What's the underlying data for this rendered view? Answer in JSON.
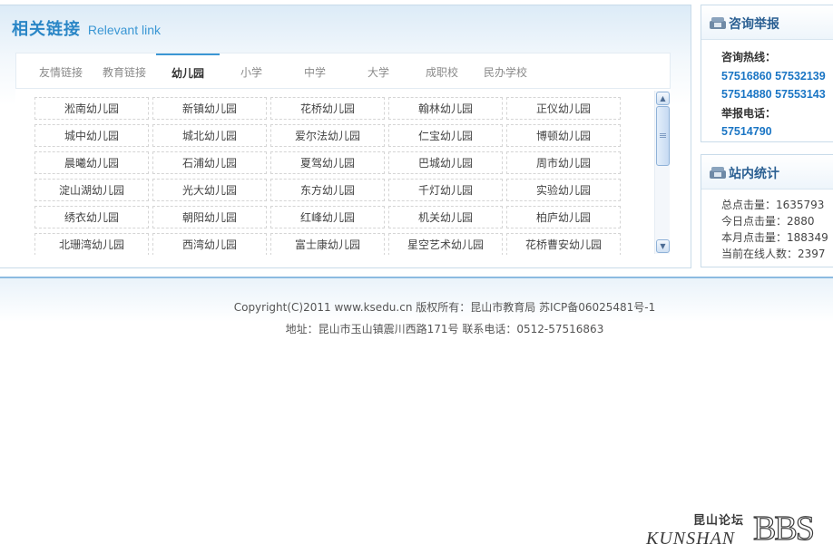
{
  "links_panel": {
    "title_zh": "相关链接",
    "title_en": "Relevant link",
    "tabs": [
      "友情链接",
      "教育链接",
      "幼儿园",
      "小学",
      "中学",
      "大学",
      "成职校",
      "民办学校"
    ],
    "active_tab": "幼儿园",
    "kindergartens": [
      [
        "淞南幼儿园",
        "新镇幼儿园",
        "花桥幼儿园",
        "翰林幼儿园",
        "正仪幼儿园"
      ],
      [
        "城中幼儿园",
        "城北幼儿园",
        "爱尔法幼儿园",
        "仁宝幼儿园",
        "博顿幼儿园"
      ],
      [
        "晨曦幼儿园",
        "石浦幼儿园",
        "夏驾幼儿园",
        "巴城幼儿园",
        "周市幼儿园"
      ],
      [
        "淀山湖幼儿园",
        "光大幼儿园",
        "东方幼儿园",
        "千灯幼儿园",
        "实验幼儿园"
      ],
      [
        "绣衣幼儿园",
        "朝阳幼儿园",
        "红峰幼儿园",
        "机关幼儿园",
        "柏庐幼儿园"
      ],
      [
        "北珊湾幼儿园",
        "西湾幼儿园",
        "富士康幼儿园",
        "星空艺术幼儿园",
        "花桥曹安幼儿园"
      ]
    ],
    "scrollbar": {
      "up_icon": "scroll-up-arrow",
      "down_icon": "scroll-down-arrow"
    }
  },
  "consult": {
    "title": "咨询举报",
    "hotline_label": "咨询热线：",
    "hotline_1": "57516860 57532139",
    "hotline_2": "57514880 57553143",
    "report_label": "举报电话：",
    "report_number": "57514790",
    "icon": "phone-icon"
  },
  "stats": {
    "title": "站内统计",
    "total_clicks": "总点击量：1635793",
    "today_clicks": "今日点击量：2880",
    "month_clicks": "本月点击量：188349",
    "online": "当前在线人数：2397",
    "icon": "stats-icon"
  },
  "footer": {
    "copyright": "Copyright(C)2011 www.ksedu.cn 版权所有：昆山市教育局 苏ICP备06025481号-1",
    "address": "地址：昆山市玉山镇震川西路171号 联系电话：0512-57516863"
  },
  "watermark": {
    "zh": "昆山论坛",
    "en": "KUNSHAN",
    "bbs": "BBS"
  },
  "colors": {
    "accent": "#3b97d4",
    "title_blue": "#2a86c6",
    "phone_blue": "#1a75c4",
    "border": "#c9dbe9"
  }
}
